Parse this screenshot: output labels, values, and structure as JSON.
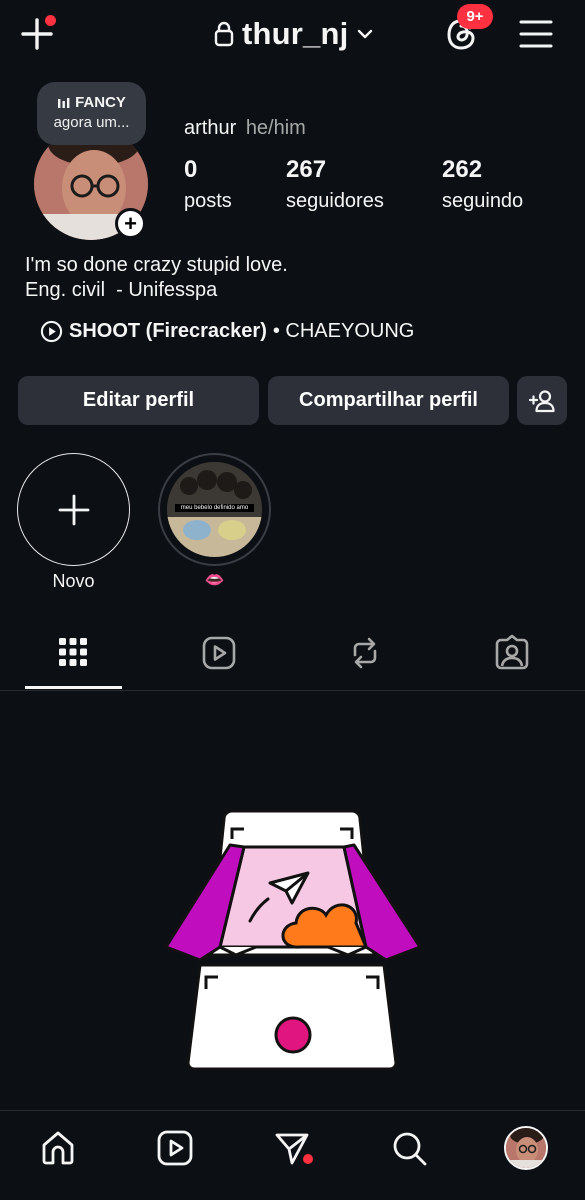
{
  "header": {
    "username": "thur_nj",
    "notification_badge": "9+",
    "icons": [
      "plus-icon",
      "lock-icon",
      "chevron-down-icon",
      "threads-icon",
      "hamburger-menu-icon"
    ]
  },
  "note": {
    "title": "FANCY",
    "subtitle": "agora um..."
  },
  "profile": {
    "name": "arthur",
    "pronouns": "he/him",
    "stats": [
      {
        "value": "0",
        "label": "posts"
      },
      {
        "value": "267",
        "label": "seguidores"
      },
      {
        "value": "262",
        "label": "seguindo"
      }
    ],
    "bio_lines": [
      "I'm so done crazy stupid love.",
      "Eng. civil  - Unifesspa"
    ],
    "music": {
      "song": "SHOOT (Firecracker)",
      "artist": "• CHAEYOUNG"
    }
  },
  "actions": {
    "edit_label": "Editar perfil",
    "share_label": "Compartilhar perfil"
  },
  "highlights": {
    "new_label": "Novo",
    "story_caption": "meu bebelo definido amo",
    "story_label": "👄"
  },
  "tabs": [
    "grid-icon",
    "reels-icon",
    "reposts-icon",
    "tagged-icon"
  ],
  "colors": {
    "background": "#0c0f14",
    "button": "#2d3038",
    "notification_red": "#ff3040",
    "magenta": "#c00dbd",
    "orange": "#ff7a1a",
    "pink": "#e0157f"
  }
}
